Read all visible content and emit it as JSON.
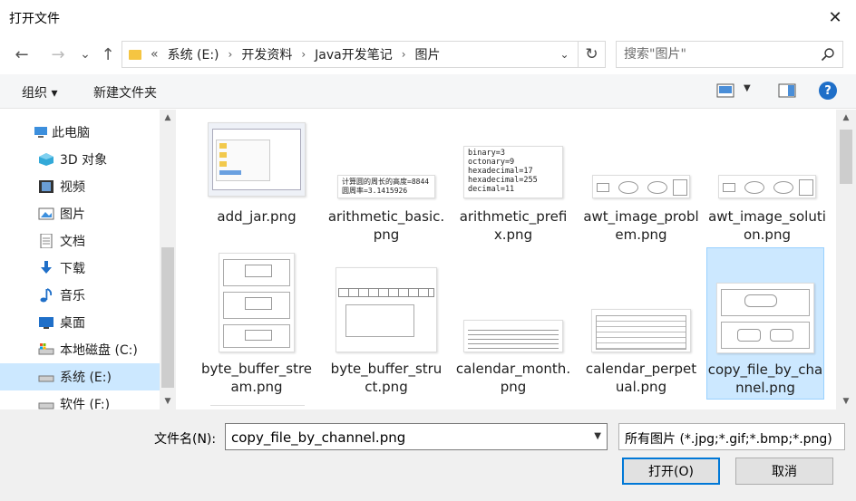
{
  "window": {
    "title": "打开文件"
  },
  "nav": {
    "back": "←",
    "forward": "→",
    "recent": "⌄",
    "up": "↑"
  },
  "address": {
    "overflow": "«",
    "crumbs": [
      "系统 (E:)",
      "开发资料",
      "Java开发笔记",
      "图片"
    ],
    "sep": "›"
  },
  "search": {
    "placeholder": "搜索\"图片\""
  },
  "toolbar": {
    "organize": "组织 ▾",
    "new_folder": "新建文件夹"
  },
  "sidebar": {
    "items": [
      {
        "label": "此电脑",
        "icon": "computer-icon"
      },
      {
        "label": "3D 对象",
        "icon": "3d-objects-icon"
      },
      {
        "label": "视频",
        "icon": "video-icon"
      },
      {
        "label": "图片",
        "icon": "picture-icon"
      },
      {
        "label": "文档",
        "icon": "document-icon"
      },
      {
        "label": "下载",
        "icon": "download-icon"
      },
      {
        "label": "音乐",
        "icon": "music-icon"
      },
      {
        "label": "桌面",
        "icon": "desktop-icon"
      },
      {
        "label": "本地磁盘 (C:)",
        "icon": "drive-icon"
      },
      {
        "label": "系统 (E:)",
        "icon": "drive-icon"
      },
      {
        "label": "软件 (F:)",
        "icon": "drive-icon"
      }
    ]
  },
  "files": [
    {
      "name": "add_jar.png"
    },
    {
      "name": "arithmetic_basic.png",
      "thumb_text": "计算圆的周长的高度=8844\n圆周率=3.1415926"
    },
    {
      "name": "arithmetic_prefix.png",
      "thumb_text": "binary=3\noctonary=9\nhexadecimal=17\nhexadecimal=255\ndecimal=11"
    },
    {
      "name": "awt_image_problem.png"
    },
    {
      "name": "awt_image_solution.png"
    },
    {
      "name": "byte_buffer_stream.png"
    },
    {
      "name": "byte_buffer_struct.png"
    },
    {
      "name": "calendar_month.png"
    },
    {
      "name": "calendar_perpetual.png"
    },
    {
      "name": "copy_file_by_channel.png",
      "selected": true
    }
  ],
  "bottom": {
    "filename_label": "文件名(N):",
    "filename_value": "copy_file_by_channel.png",
    "filter_value": "所有图片 (*.jpg;*.gif;*.bmp;*.png)",
    "open_label": "打开(O)",
    "cancel_label": "取消"
  },
  "colors": {
    "selection": "#cce8ff",
    "accent": "#0078d7"
  }
}
